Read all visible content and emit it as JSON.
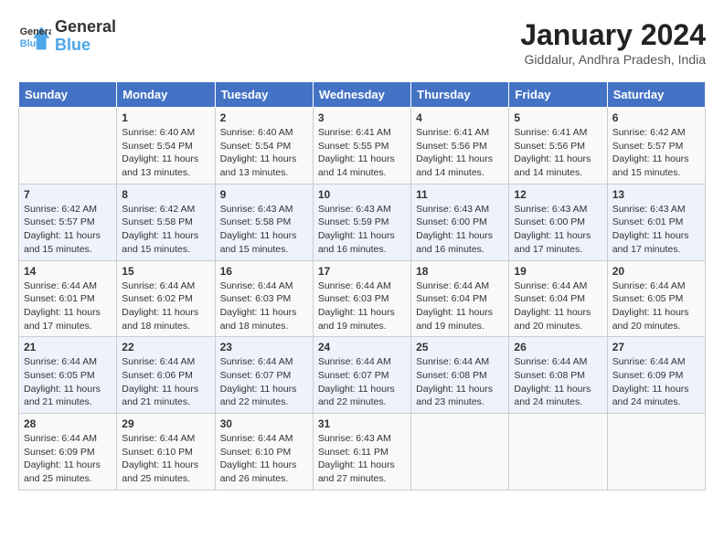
{
  "header": {
    "logo_line1": "General",
    "logo_line2": "Blue",
    "title": "January 2024",
    "subtitle": "Giddalur, Andhra Pradesh, India"
  },
  "days_of_week": [
    "Sunday",
    "Monday",
    "Tuesday",
    "Wednesday",
    "Thursday",
    "Friday",
    "Saturday"
  ],
  "weeks": [
    [
      {
        "num": "",
        "info": ""
      },
      {
        "num": "1",
        "info": "Sunrise: 6:40 AM\nSunset: 5:54 PM\nDaylight: 11 hours\nand 13 minutes."
      },
      {
        "num": "2",
        "info": "Sunrise: 6:40 AM\nSunset: 5:54 PM\nDaylight: 11 hours\nand 13 minutes."
      },
      {
        "num": "3",
        "info": "Sunrise: 6:41 AM\nSunset: 5:55 PM\nDaylight: 11 hours\nand 14 minutes."
      },
      {
        "num": "4",
        "info": "Sunrise: 6:41 AM\nSunset: 5:56 PM\nDaylight: 11 hours\nand 14 minutes."
      },
      {
        "num": "5",
        "info": "Sunrise: 6:41 AM\nSunset: 5:56 PM\nDaylight: 11 hours\nand 14 minutes."
      },
      {
        "num": "6",
        "info": "Sunrise: 6:42 AM\nSunset: 5:57 PM\nDaylight: 11 hours\nand 15 minutes."
      }
    ],
    [
      {
        "num": "7",
        "info": "Sunrise: 6:42 AM\nSunset: 5:57 PM\nDaylight: 11 hours\nand 15 minutes."
      },
      {
        "num": "8",
        "info": "Sunrise: 6:42 AM\nSunset: 5:58 PM\nDaylight: 11 hours\nand 15 minutes."
      },
      {
        "num": "9",
        "info": "Sunrise: 6:43 AM\nSunset: 5:58 PM\nDaylight: 11 hours\nand 15 minutes."
      },
      {
        "num": "10",
        "info": "Sunrise: 6:43 AM\nSunset: 5:59 PM\nDaylight: 11 hours\nand 16 minutes."
      },
      {
        "num": "11",
        "info": "Sunrise: 6:43 AM\nSunset: 6:00 PM\nDaylight: 11 hours\nand 16 minutes."
      },
      {
        "num": "12",
        "info": "Sunrise: 6:43 AM\nSunset: 6:00 PM\nDaylight: 11 hours\nand 17 minutes."
      },
      {
        "num": "13",
        "info": "Sunrise: 6:43 AM\nSunset: 6:01 PM\nDaylight: 11 hours\nand 17 minutes."
      }
    ],
    [
      {
        "num": "14",
        "info": "Sunrise: 6:44 AM\nSunset: 6:01 PM\nDaylight: 11 hours\nand 17 minutes."
      },
      {
        "num": "15",
        "info": "Sunrise: 6:44 AM\nSunset: 6:02 PM\nDaylight: 11 hours\nand 18 minutes."
      },
      {
        "num": "16",
        "info": "Sunrise: 6:44 AM\nSunset: 6:03 PM\nDaylight: 11 hours\nand 18 minutes."
      },
      {
        "num": "17",
        "info": "Sunrise: 6:44 AM\nSunset: 6:03 PM\nDaylight: 11 hours\nand 19 minutes."
      },
      {
        "num": "18",
        "info": "Sunrise: 6:44 AM\nSunset: 6:04 PM\nDaylight: 11 hours\nand 19 minutes."
      },
      {
        "num": "19",
        "info": "Sunrise: 6:44 AM\nSunset: 6:04 PM\nDaylight: 11 hours\nand 20 minutes."
      },
      {
        "num": "20",
        "info": "Sunrise: 6:44 AM\nSunset: 6:05 PM\nDaylight: 11 hours\nand 20 minutes."
      }
    ],
    [
      {
        "num": "21",
        "info": "Sunrise: 6:44 AM\nSunset: 6:05 PM\nDaylight: 11 hours\nand 21 minutes."
      },
      {
        "num": "22",
        "info": "Sunrise: 6:44 AM\nSunset: 6:06 PM\nDaylight: 11 hours\nand 21 minutes."
      },
      {
        "num": "23",
        "info": "Sunrise: 6:44 AM\nSunset: 6:07 PM\nDaylight: 11 hours\nand 22 minutes."
      },
      {
        "num": "24",
        "info": "Sunrise: 6:44 AM\nSunset: 6:07 PM\nDaylight: 11 hours\nand 22 minutes."
      },
      {
        "num": "25",
        "info": "Sunrise: 6:44 AM\nSunset: 6:08 PM\nDaylight: 11 hours\nand 23 minutes."
      },
      {
        "num": "26",
        "info": "Sunrise: 6:44 AM\nSunset: 6:08 PM\nDaylight: 11 hours\nand 24 minutes."
      },
      {
        "num": "27",
        "info": "Sunrise: 6:44 AM\nSunset: 6:09 PM\nDaylight: 11 hours\nand 24 minutes."
      }
    ],
    [
      {
        "num": "28",
        "info": "Sunrise: 6:44 AM\nSunset: 6:09 PM\nDaylight: 11 hours\nand 25 minutes."
      },
      {
        "num": "29",
        "info": "Sunrise: 6:44 AM\nSunset: 6:10 PM\nDaylight: 11 hours\nand 25 minutes."
      },
      {
        "num": "30",
        "info": "Sunrise: 6:44 AM\nSunset: 6:10 PM\nDaylight: 11 hours\nand 26 minutes."
      },
      {
        "num": "31",
        "info": "Sunrise: 6:43 AM\nSunset: 6:11 PM\nDaylight: 11 hours\nand 27 minutes."
      },
      {
        "num": "",
        "info": ""
      },
      {
        "num": "",
        "info": ""
      },
      {
        "num": "",
        "info": ""
      }
    ]
  ]
}
